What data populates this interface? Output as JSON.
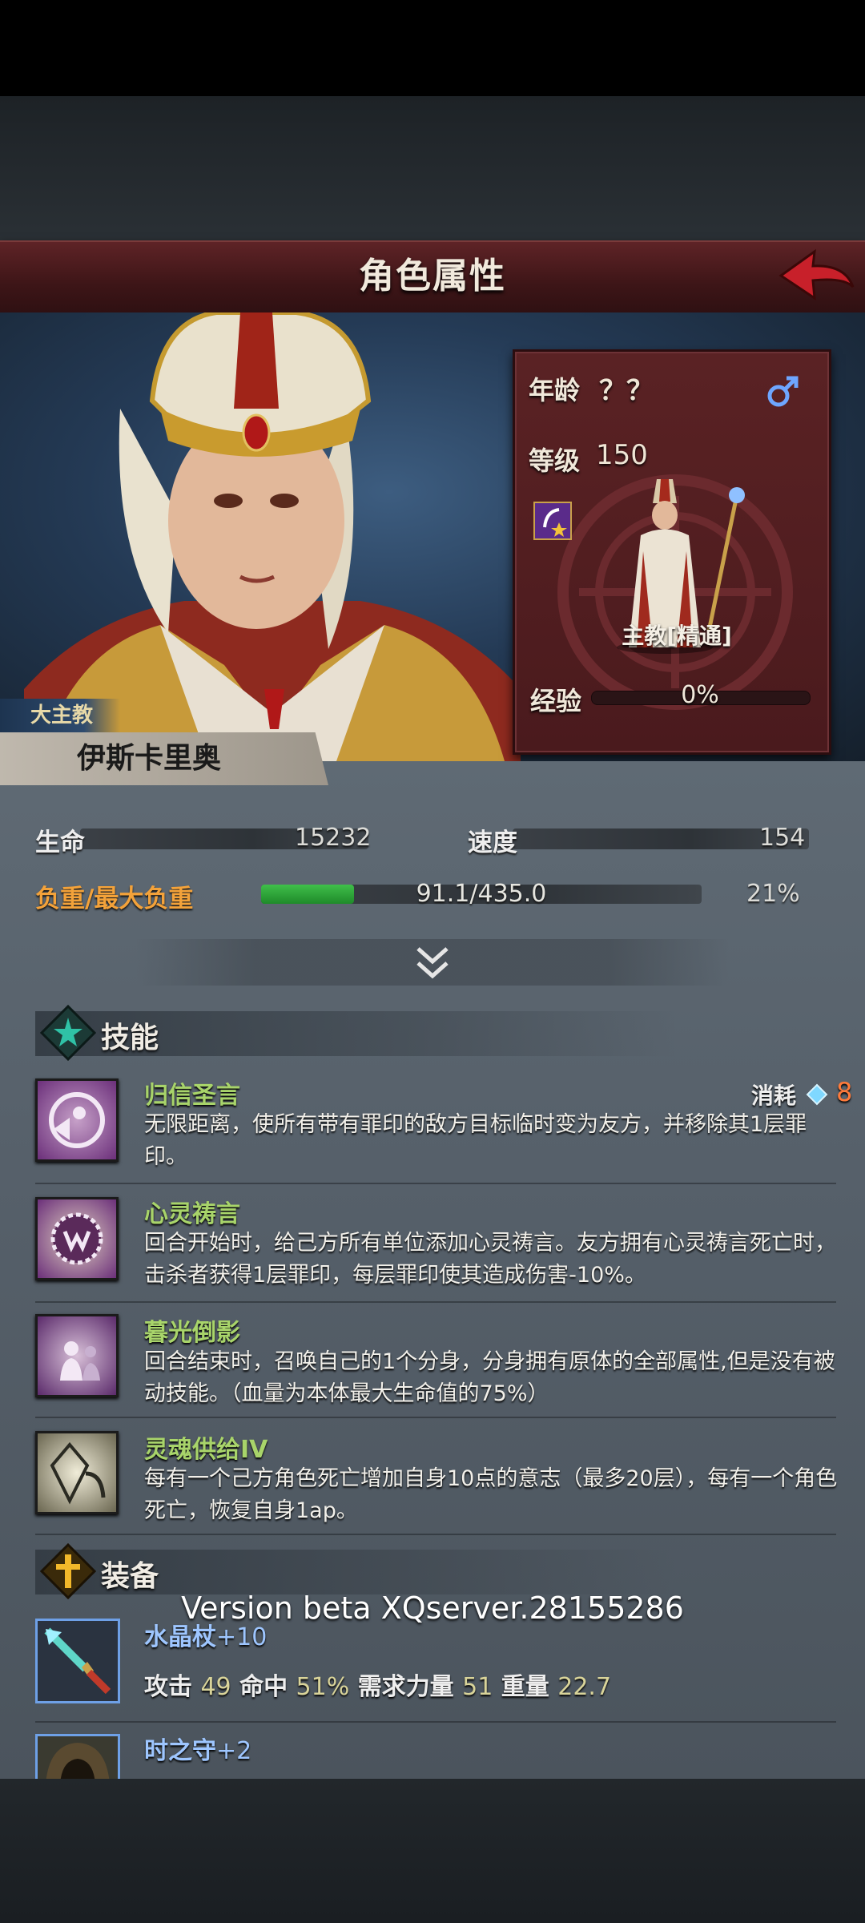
{
  "header": {
    "title": "角色属性"
  },
  "character": {
    "age_label": "年龄",
    "age_value": "？？",
    "level_label": "等级",
    "level_value": "150",
    "class_name": "主教[精通]",
    "exp_label": "经验",
    "exp_value": "0%",
    "exp_fraction": 0,
    "title": "大主教",
    "name": "伊斯卡里奥"
  },
  "stats": {
    "hp_label": "生命",
    "hp_value": "15232",
    "speed_label": "速度",
    "speed_value": "154",
    "load_label": "负重/最大负重",
    "load_value": "91.1/435.0",
    "load_percent": "21%",
    "load_fraction": 0.21
  },
  "skills_section": {
    "title": "技能",
    "cost_label": "消耗",
    "cost_value": "8",
    "items": [
      {
        "name": "归信圣言",
        "desc": "无限距离，使所有带有罪印的敌方目标临时变为友方，并移除其1层罪印。",
        "icon": "conversion-skill-icon"
      },
      {
        "name": "心灵祷言",
        "desc": "回合开始时，给己方所有单位添加心灵祷言。友方拥有心灵祷言死亡时，击杀者获得1层罪印，每层罪印使其造成伤害-10%。",
        "icon": "mind-prayer-skill-icon"
      },
      {
        "name": "暮光倒影",
        "desc": "回合结束时，召唤自己的1个分身，分身拥有原体的全部属性,但是没有被动技能。（血量为本体最大生命值的75%）",
        "icon": "twilight-reflection-skill-icon"
      },
      {
        "name": "灵魂供给IV",
        "desc": "每有一个己方角色死亡增加自身10点的意志（最多20层），每有一个角色死亡，恢复自身1ap。",
        "icon": "soul-supply-skill-icon"
      }
    ]
  },
  "equipment_section": {
    "title": "装备",
    "items": [
      {
        "name": "水晶杖",
        "level": "+10",
        "stat_attack_label": "攻击",
        "stat_attack": "49",
        "stat_hit_label": "命中",
        "stat_hit": "51%",
        "stat_req_label": "需求力量",
        "stat_req": "51",
        "stat_weight_label": "重量",
        "stat_weight": "22.7"
      },
      {
        "name": "时之守",
        "level": "+2"
      }
    ]
  },
  "version": "Version beta XQserver.28155286",
  "colors": {
    "header": "#4a1a1d",
    "skill_name": "#a8d46a",
    "equip_name": "#9ec6ff",
    "cost_value": "#ff7a3a",
    "gem": "#7fd8ff"
  }
}
